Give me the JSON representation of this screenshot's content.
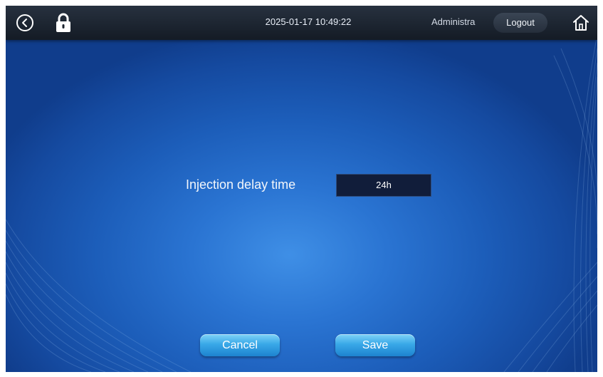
{
  "header": {
    "datetime": "2025-01-17 10:49:22",
    "user": "Administra",
    "logout_label": "Logout",
    "icons": [
      "back-icon",
      "lock-icon",
      "home-icon"
    ]
  },
  "form": {
    "label": "Injection delay time",
    "value": "24h"
  },
  "actions": {
    "cancel_label": "Cancel",
    "save_label": "Save"
  },
  "colors": {
    "background_center": "#3f8fe6",
    "background_edge": "#103d8c",
    "topbar": "#1b232e",
    "input_bg": "#111d3a",
    "button": "#39a8e8"
  }
}
